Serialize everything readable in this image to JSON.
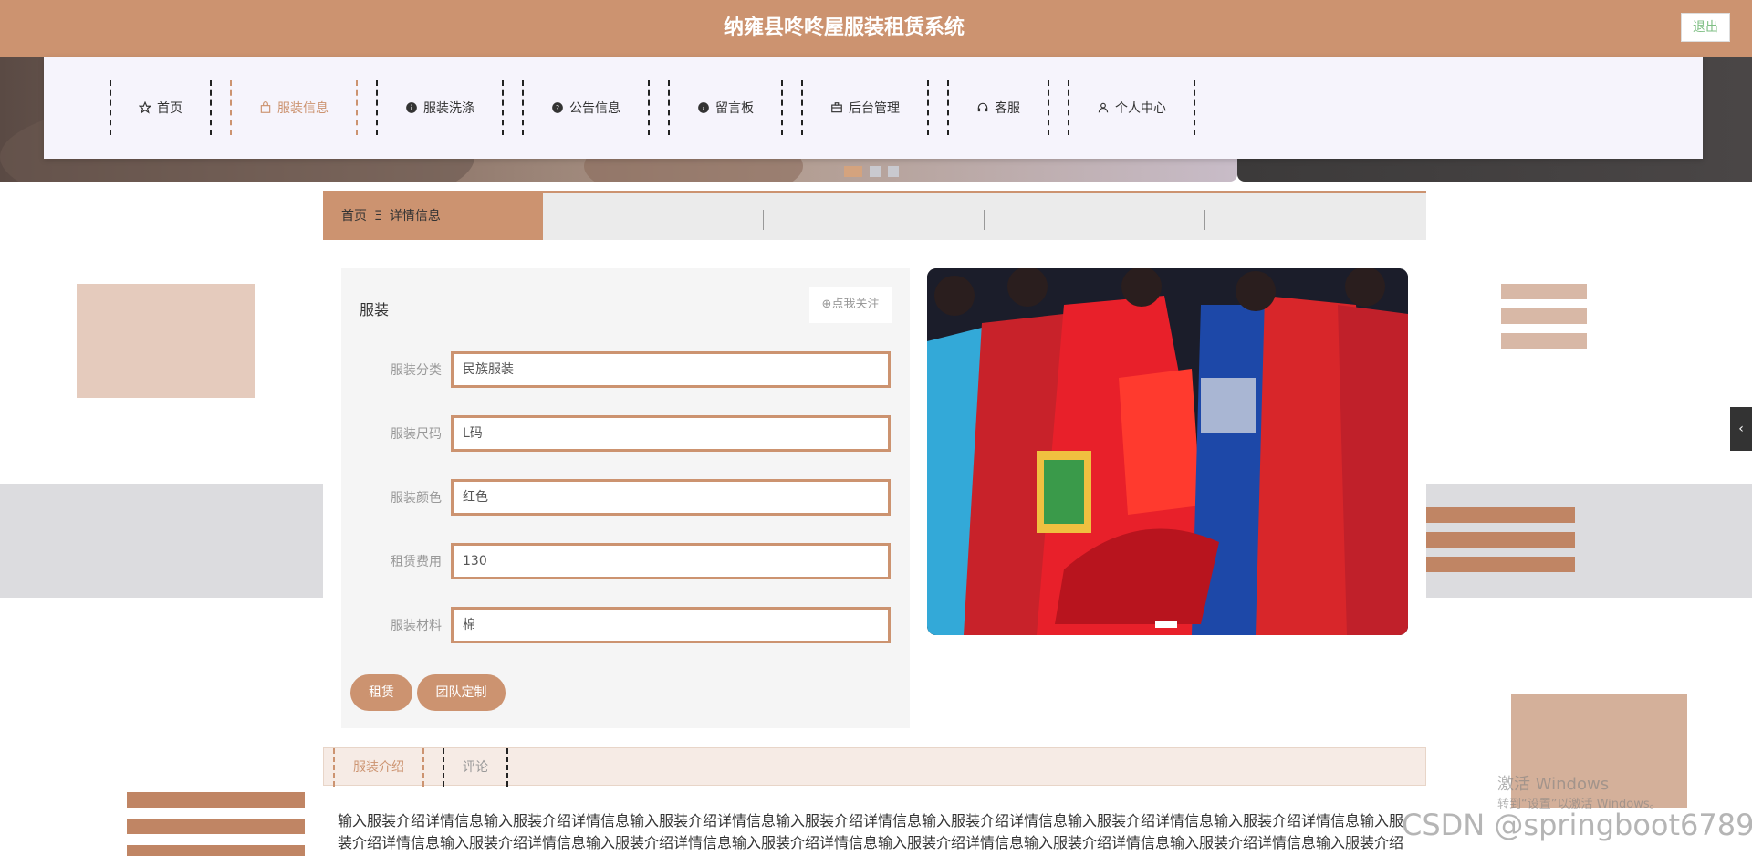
{
  "header": {
    "title": "纳雍县咚咚屋服装租赁系统",
    "logout_label": "退出"
  },
  "nav": {
    "items": [
      {
        "label": "首页",
        "icon": "star-icon"
      },
      {
        "label": "服装信息",
        "icon": "bag-icon",
        "active": true
      },
      {
        "label": "服装洗涤",
        "icon": "info-circle-icon"
      },
      {
        "label": "公告信息",
        "icon": "question-circle-icon"
      },
      {
        "label": "留言板",
        "icon": "info-circle-icon"
      },
      {
        "label": "后台管理",
        "icon": "briefcase-icon"
      },
      {
        "label": "客服",
        "icon": "headset-icon"
      },
      {
        "label": "个人中心",
        "icon": "user-icon"
      }
    ]
  },
  "breadcrumb": {
    "home": "首页",
    "separator": "Ξ",
    "current": "详情信息"
  },
  "detail": {
    "title": "服装",
    "follow_label": "⊕点我关注",
    "fields": [
      {
        "label": "服装分类",
        "value": "民族服装"
      },
      {
        "label": "服装尺码",
        "value": "L码"
      },
      {
        "label": "服装颜色",
        "value": "红色"
      },
      {
        "label": "租赁费用",
        "value": "130"
      },
      {
        "label": "服装材料",
        "value": "棉"
      }
    ],
    "rent_label": "租赁",
    "custom_label": "团队定制"
  },
  "tabs": [
    {
      "label": "服装介绍",
      "active": true
    },
    {
      "label": "评论"
    }
  ],
  "description": "输入服装介绍详情信息输入服装介绍详情信息输入服装介绍详情信息输入服装介绍详情信息输入服装介绍详情信息输入服装介绍详情信息输入服装介绍详情信息输入服装介绍详情信息输入服装介绍详情信息输入服装介绍详情信息输入服装介绍详情信息输入服装介绍详情信息输入服装介绍详情信息输入服装介绍详情信息输入服装介绍详情信息输入服装介绍详情信息输入服装介绍",
  "overlay": {
    "watermark": "CSDN @springboot6789",
    "windows_activate": "激活 Windows",
    "windows_activate_hint": "转到“设置”以激活 Windows。"
  },
  "colors": {
    "accent": "#cc9370",
    "nav_bg": "#f6f4fc",
    "card_bg": "#f5f5f5"
  }
}
